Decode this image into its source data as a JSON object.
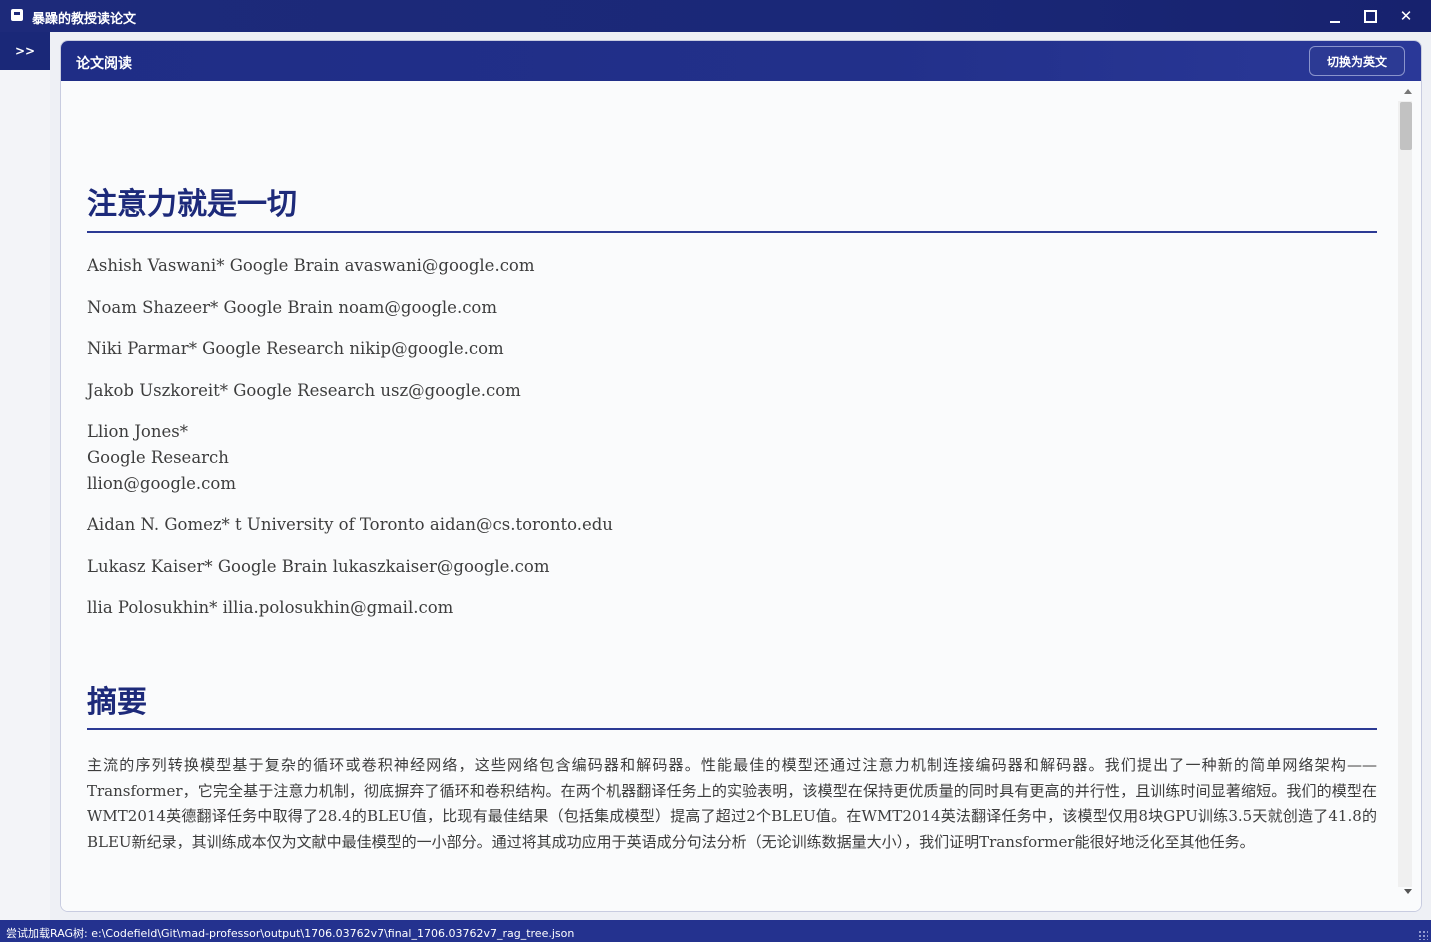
{
  "window": {
    "title": "暴躁的教授读论文",
    "minimize_icon": "minimize-icon",
    "maximize_icon": "maximize-icon",
    "close_icon": "close-icon",
    "close_glyph": "✕"
  },
  "sidebar": {
    "toggle_label": ">>"
  },
  "panel": {
    "title": "论文阅读",
    "switch_button_label": "切换为英文"
  },
  "document": {
    "title": "注意力就是一切",
    "authors": [
      {
        "lines": [
          "Ashish Vaswani* Google Brain avaswani@google.com"
        ]
      },
      {
        "lines": [
          "Noam Shazeer* Google Brain noam@google.com"
        ]
      },
      {
        "lines": [
          "Niki Parmar* Google Research nikip@google.com"
        ]
      },
      {
        "lines": [
          "Jakob Uszkoreit* Google Research usz@google.com"
        ]
      },
      {
        "lines": [
          "Llion Jones*",
          "Google Research",
          "llion@google.com"
        ]
      },
      {
        "lines": [
          "Aidan N. Gomez* t University of Toronto aidan@cs.toronto.edu"
        ]
      },
      {
        "lines": [
          "Lukasz Kaiser* Google Brain lukaszkaiser@google.com"
        ]
      },
      {
        "lines": [
          "llia Polosukhin* illia.polosukhin@gmail.com"
        ]
      }
    ],
    "abstract_heading": "摘要",
    "abstract_text": "主流的序列转换模型基于复杂的循环或卷积神经网络，这些网络包含编码器和解码器。性能最佳的模型还通过注意力机制连接编码器和解码器。我们提出了一种新的简单网络架构——Transformer，它完全基于注意力机制，彻底摒弃了循环和卷积结构。在两个机器翻译任务上的实验表明，该模型在保持更优质量的同时具有更高的并行性，且训练时间显著缩短。我们的模型在WMT2014英德翻译任务中取得了28.4的BLEU值，比现有最佳结果（包括集成模型）提高了超过2个BLEU值。在WMT2014英法翻译任务中，该模型仅用8块GPU训练3.5天就创造了41.8的BLEU新纪录，其训练成本仅为文献中最佳模型的一小部分。通过将其成功应用于英语成分句法分析（无论训练数据量大小），我们证明Transformer能很好地泛化至其他任务。"
  },
  "status_bar": {
    "text": "尝试加载RAG树: e:\\Codefield\\Git\\mad-professor\\output\\1706.03762v7\\final_1706.03762v7_rag_tree.json"
  },
  "colors": {
    "accent": "#1d2a7a",
    "header": "#1f2d86",
    "status_bar": "#24328f",
    "heading_text": "#1d2a7a"
  }
}
